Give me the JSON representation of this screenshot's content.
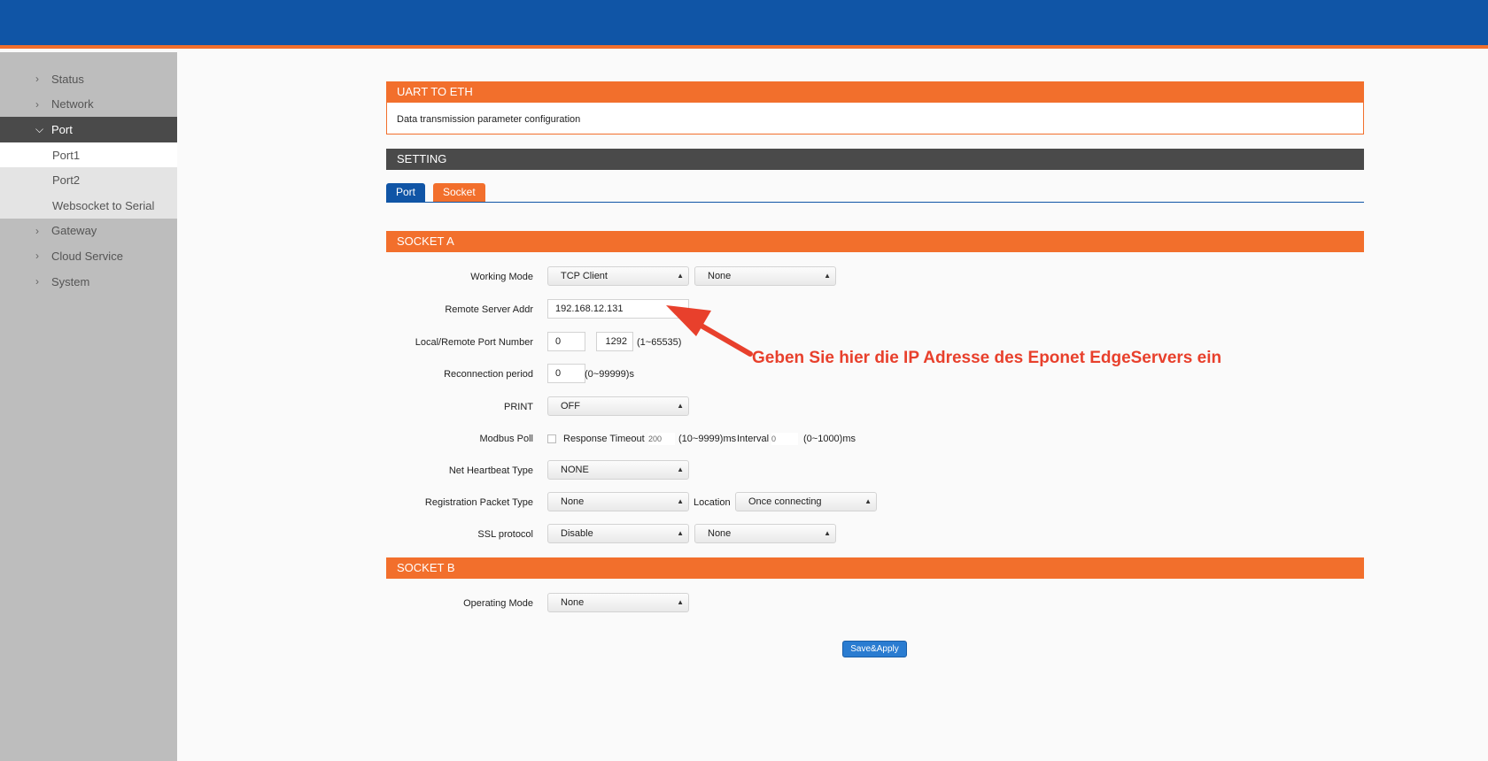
{
  "sidebar": {
    "items": [
      {
        "label": "Status"
      },
      {
        "label": "Network"
      },
      {
        "label": "Port"
      },
      {
        "label": "Gateway"
      },
      {
        "label": "Cloud Service"
      },
      {
        "label": "System"
      }
    ],
    "port_sub": [
      "Port1",
      "Port2",
      "Websocket to Serial"
    ]
  },
  "uart": {
    "title": "UART TO ETH",
    "description": "Data transmission parameter configuration"
  },
  "setting": {
    "title": "SETTING",
    "tabs": [
      "Port",
      "Socket"
    ]
  },
  "socket_a": {
    "title": "SOCKET A",
    "working_mode": {
      "label": "Working Mode",
      "value": "TCP Client",
      "value2": "None"
    },
    "remote_server": {
      "label": "Remote Server Addr",
      "value": "192.168.12.131"
    },
    "port_number": {
      "label": "Local/Remote Port Number",
      "local": "0",
      "remote": "1292",
      "range": "(1~65535)"
    },
    "reconnection": {
      "label": "Reconnection period",
      "value": "0",
      "range": "(0~99999)s"
    },
    "print": {
      "label": "PRINT",
      "value": "OFF"
    },
    "modbus_poll": {
      "label": "Modbus Poll",
      "response_label": "Response Timeout",
      "response_value": "200",
      "response_range": "(10~9999)ms",
      "interval_label": "Interval",
      "interval_value": "0",
      "interval_range": "(0~1000)ms"
    },
    "heartbeat": {
      "label": "Net Heartbeat Type",
      "value": "NONE"
    },
    "registration": {
      "label": "Registration Packet Type",
      "value": "None",
      "location_label": "Location",
      "location_value": "Once connecting"
    },
    "ssl": {
      "label": "SSL protocol",
      "value": "Disable",
      "value2": "None"
    }
  },
  "socket_b": {
    "title": "SOCKET B",
    "operating_mode": {
      "label": "Operating Mode",
      "value": "None"
    }
  },
  "save_label": "Save&Apply",
  "annotation": "Geben Sie hier die IP Adresse des Eponet EdgeServers ein",
  "colors": {
    "header_blue": "#1055a6",
    "accent_orange": "#f26f2c",
    "annotation_red": "#e8402c"
  }
}
